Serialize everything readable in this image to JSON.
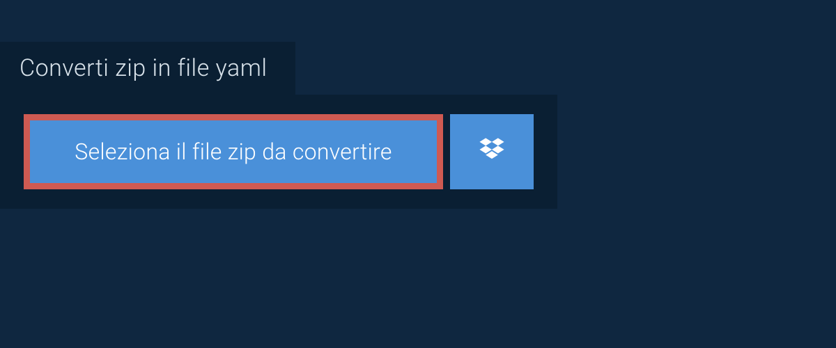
{
  "tab": {
    "label": "Converti zip in file yaml"
  },
  "buttons": {
    "select": "Seleziona il file zip da convertire"
  }
}
